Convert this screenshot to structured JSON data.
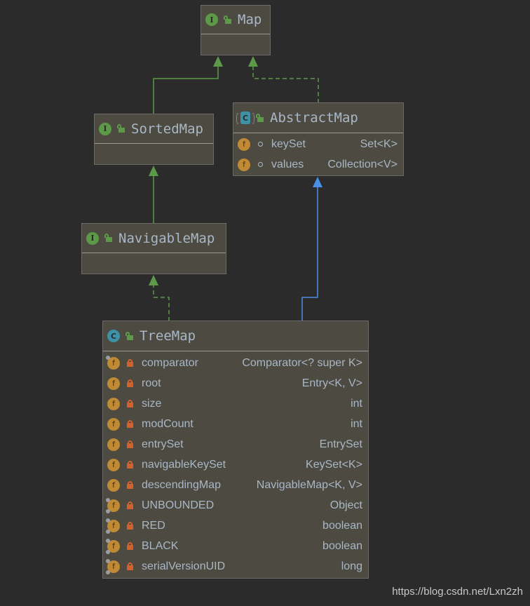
{
  "diagram": {
    "nodes": {
      "map": {
        "name": "Map",
        "kind": "interface",
        "icon": "interface-icon",
        "visibility": "public"
      },
      "sorted_map": {
        "name": "SortedMap",
        "kind": "interface",
        "icon": "interface-icon",
        "visibility": "public"
      },
      "navigable_map": {
        "name": "NavigableMap",
        "kind": "interface",
        "icon": "interface-icon",
        "visibility": "public"
      },
      "abstract_map": {
        "name": "AbstractMap",
        "kind": "abstract-class",
        "icon": "abstract-class-icon",
        "visibility": "public",
        "fields": [
          {
            "name": "keySet",
            "type": "Set<K>",
            "modifier": "package-private"
          },
          {
            "name": "values",
            "type": "Collection<V>",
            "modifier": "package-private"
          }
        ]
      },
      "tree_map": {
        "name": "TreeMap",
        "kind": "class",
        "icon": "class-icon",
        "visibility": "public",
        "fields": [
          {
            "name": "comparator",
            "type": "Comparator<? super K>",
            "modifier": "private final"
          },
          {
            "name": "root",
            "type": "Entry<K, V>",
            "modifier": "private"
          },
          {
            "name": "size",
            "type": "int",
            "modifier": "private"
          },
          {
            "name": "modCount",
            "type": "int",
            "modifier": "private"
          },
          {
            "name": "entrySet",
            "type": "EntrySet",
            "modifier": "private"
          },
          {
            "name": "navigableKeySet",
            "type": "KeySet<K>",
            "modifier": "private"
          },
          {
            "name": "descendingMap",
            "type": "NavigableMap<K, V>",
            "modifier": "private"
          },
          {
            "name": "UNBOUNDED",
            "type": "Object",
            "modifier": "private static final"
          },
          {
            "name": "RED",
            "type": "boolean",
            "modifier": "private static final"
          },
          {
            "name": "BLACK",
            "type": "boolean",
            "modifier": "private static final"
          },
          {
            "name": "serialVersionUID",
            "type": "long",
            "modifier": "private static final"
          }
        ]
      }
    },
    "edges": [
      {
        "from": "SortedMap",
        "to": "Map",
        "relation": "extends"
      },
      {
        "from": "AbstractMap",
        "to": "Map",
        "relation": "implements"
      },
      {
        "from": "NavigableMap",
        "to": "SortedMap",
        "relation": "extends"
      },
      {
        "from": "TreeMap",
        "to": "NavigableMap",
        "relation": "implements"
      },
      {
        "from": "TreeMap",
        "to": "AbstractMap",
        "relation": "extends"
      }
    ],
    "colors": {
      "background": "#2b2b2b",
      "node_fill": "#4c4a41",
      "interface_edge": "#5d9a48",
      "class_edge": "#4a8fe7",
      "text": "#a9b7c6"
    }
  },
  "watermark": "https://blog.csdn.net/Lxn2zh"
}
